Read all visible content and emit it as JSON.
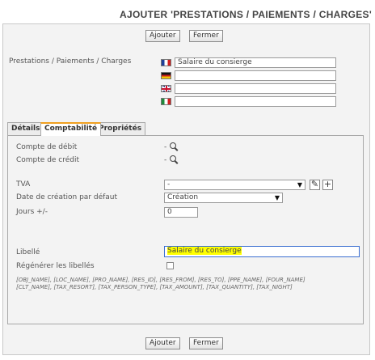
{
  "page": {
    "title": "AJOUTER 'PRESTATIONS / PAIEMENTS / CHARGES'"
  },
  "top_actions": {
    "add_label": "Ajouter",
    "close_label": "Fermer"
  },
  "bottom_actions": {
    "add_label": "Ajouter",
    "close_label": "Fermer"
  },
  "translations": {
    "label": "Prestations / Paiements / Charges",
    "fields": [
      {
        "lang": "fr",
        "icon": "flag-france-icon",
        "value": "Salaire du consierge"
      },
      {
        "lang": "de",
        "icon": "flag-germany-icon",
        "value": ""
      },
      {
        "lang": "en",
        "icon": "flag-uk-icon",
        "value": ""
      },
      {
        "lang": "it",
        "icon": "flag-italy-icon",
        "value": ""
      }
    ]
  },
  "tabs": [
    {
      "label": "Détails",
      "active": false
    },
    {
      "label": "Comptabilité",
      "active": true
    },
    {
      "label": "Propriétés",
      "active": false
    }
  ],
  "accounting": {
    "debit_label": "Compte de débit",
    "debit_value": "-",
    "credit_label": "Compte de crédit",
    "credit_value": "-",
    "tva_label": "TVA",
    "tva_value": "-",
    "creation_date_label": "Date de création par défaut",
    "creation_date_value": "Création",
    "days_label": "Jours +/-",
    "days_value": "0",
    "libelle_label": "Libellé",
    "libelle_value": "Salaire du consierge",
    "regenerate_label": "Régénérer les libellés",
    "regenerate_checked": false,
    "placeholders_line1": "[OBJ_NAME], [LOC_NAME], [PRO_NAME], [RES_ID], [RES_FROM], [RES_TO], [PPE_NAME], [FOUR_NAME]",
    "placeholders_line2": "[CLT_NAME], [TAX_RESORT], [TAX_PERSON_TYPE], [TAX_AMOUNT], [TAX_QUANTITY], [TAX_NIGHT]"
  },
  "colors": {
    "active_tab_accent": "#f0a020",
    "highlight": "#ffff00",
    "focus_border": "#3b6fd1"
  }
}
